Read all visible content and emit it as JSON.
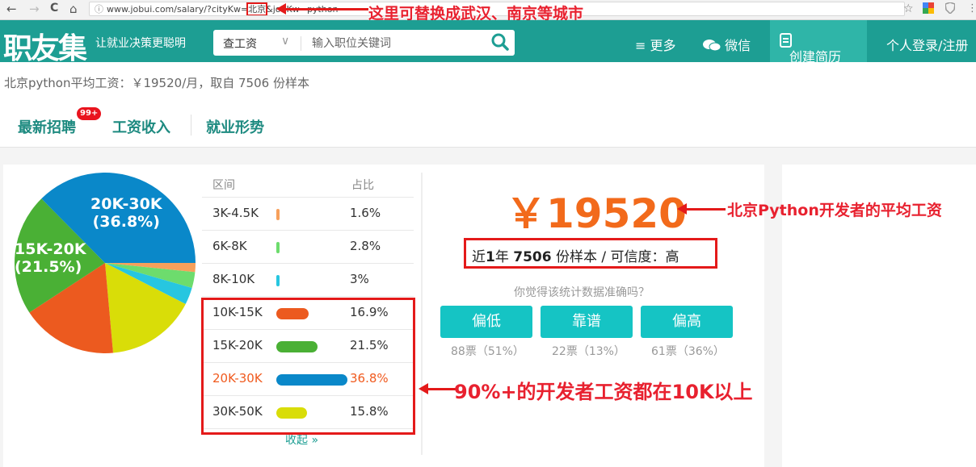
{
  "browser": {
    "back_icon": "←",
    "forward_icon": "→",
    "reload_icon": "C",
    "home_icon": "⌂",
    "url_info_icon": "ⓘ",
    "url_prefix": "www.jobui.com/salary/?cityKw=",
    "url_city": "北京",
    "url_suffix": "&jobKw=python",
    "star_icon": "☆",
    "menu_icon": "⋮"
  },
  "annotations": {
    "url_note": "这里可替换成武汉、南京等城市",
    "avg_note": "北京Python开发者的平均工资",
    "range_note": "90%+的开发者工资都在10K以上"
  },
  "header": {
    "logo": "职友集",
    "slogan": "让就业决策更聪明",
    "search_select": "查工资",
    "search_placeholder": "输入职位关键词",
    "nav_more": "≡ 更多",
    "nav_wechat": "微信",
    "create_resume": "创建简历",
    "login": "个人登录/注册"
  },
  "summary": "北京python平均工资：￥19520/月，取自 7506 份样本",
  "tabs": {
    "latest": "最新招聘",
    "badge": "99+",
    "salary": "工资收入",
    "trend": "就业形势"
  },
  "table": {
    "head_range": "区间",
    "head_ratio": "占比",
    "collapse": "收起 »",
    "rows": [
      {
        "range": "3K-4.5K",
        "ratio": "1.6%",
        "value": 1.6,
        "color": "#f7a05b"
      },
      {
        "range": "6K-8K",
        "ratio": "2.8%",
        "value": 2.8,
        "color": "#6ddc6d"
      },
      {
        "range": "8K-10K",
        "ratio": "3%",
        "value": 3.0,
        "color": "#27c6e0"
      },
      {
        "range": "10K-15K",
        "ratio": "16.9%",
        "value": 16.9,
        "color": "#ec5a1f"
      },
      {
        "range": "15K-20K",
        "ratio": "21.5%",
        "value": 21.5,
        "color": "#4ab035"
      },
      {
        "range": "20K-30K",
        "ratio": "36.8%",
        "value": 36.8,
        "color": "#0a88c9"
      },
      {
        "range": "30K-50K",
        "ratio": "15.8%",
        "value": 15.8,
        "color": "#d9dd08"
      }
    ]
  },
  "pie_labels": {
    "a_range": "20K-30K",
    "a_pct": "(36.8%)",
    "b_range": "15K-20K",
    "b_pct": "(21.5%)"
  },
  "stats": {
    "avg_salary": "￥19520",
    "samples_prefix": "近",
    "samples_year": "1",
    "samples_mid": "年 ",
    "samples_count": "7506",
    "samples_rest": " 份样本 / 可信度：高",
    "question": "你觉得该统计数据准确吗？",
    "vote_low": "偏低",
    "vote_ok": "靠谱",
    "vote_high": "偏高",
    "count_low": "88票（51%）",
    "count_ok": "22票（13%）",
    "count_high": "61票（36%）"
  }
}
